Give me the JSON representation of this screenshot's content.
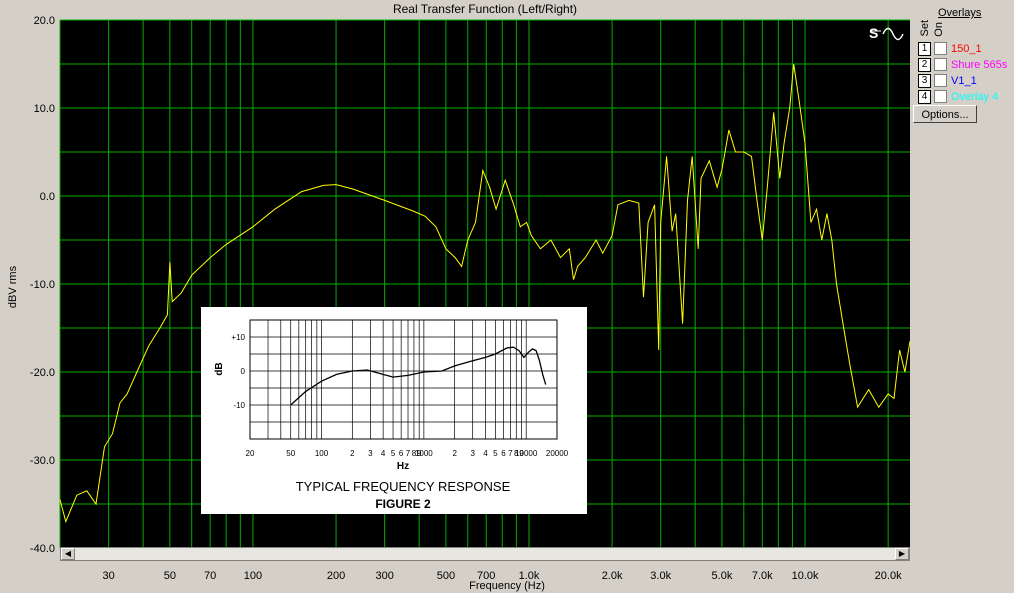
{
  "window": {
    "title": "Real Transfer Function (Left/Right)"
  },
  "overlays": {
    "title": "Overlays",
    "set_label": "Set",
    "on_label": "On",
    "items": [
      {
        "num": "1",
        "name": "150_1",
        "color": "#ff0000"
      },
      {
        "num": "2",
        "name": "Shure 565s",
        "color": "#ff00ff"
      },
      {
        "num": "3",
        "name": "V1_1",
        "color": "#0000ff"
      },
      {
        "num": "4",
        "name": "Overlay 4",
        "color": "#00ffff"
      }
    ],
    "options_label": "Options..."
  },
  "colors": {
    "plot_bg": "#000000",
    "grid": "#00b000",
    "trace": "#ffff00"
  },
  "chart_data": {
    "type": "line",
    "title": "Real Transfer Function (Left/Right)",
    "xlabel": "Frequency (Hz)",
    "ylabel": "dBV rms",
    "x_scale": "log",
    "xlim": [
      20,
      24000
    ],
    "ylim": [
      -40,
      20
    ],
    "grid": true,
    "y_ticks": [
      "20.0",
      "10.0",
      "0.0",
      "-10.0",
      "-20.0",
      "-30.0",
      "-40.0"
    ],
    "x_ticks": [
      {
        "v": 30,
        "t": "30"
      },
      {
        "v": 50,
        "t": "50"
      },
      {
        "v": 70,
        "t": "70"
      },
      {
        "v": 100,
        "t": "100"
      },
      {
        "v": 200,
        "t": "200"
      },
      {
        "v": 300,
        "t": "300"
      },
      {
        "v": 500,
        "t": "500"
      },
      {
        "v": 700,
        "t": "700"
      },
      {
        "v": 1000,
        "t": "1.0k"
      },
      {
        "v": 2000,
        "t": "2.0k"
      },
      {
        "v": 3000,
        "t": "3.0k"
      },
      {
        "v": 5000,
        "t": "5.0k"
      },
      {
        "v": 7000,
        "t": "7.0k"
      },
      {
        "v": 10000,
        "t": "10.0k"
      },
      {
        "v": 20000,
        "t": "20.0k"
      }
    ],
    "series": [
      {
        "points": [
          [
            20,
            -34.5
          ],
          [
            21,
            -37
          ],
          [
            23,
            -34
          ],
          [
            25,
            -33.5
          ],
          [
            27,
            -35
          ],
          [
            29,
            -28.5
          ],
          [
            31,
            -27
          ],
          [
            33,
            -23.5
          ],
          [
            35,
            -22.5
          ],
          [
            38,
            -20
          ],
          [
            42,
            -17
          ],
          [
            46,
            -15
          ],
          [
            49,
            -13.5
          ],
          [
            50,
            -7.5
          ],
          [
            51,
            -12
          ],
          [
            55,
            -11
          ],
          [
            60,
            -9
          ],
          [
            70,
            -7
          ],
          [
            80,
            -5.5
          ],
          [
            100,
            -3.5
          ],
          [
            120,
            -1.5
          ],
          [
            150,
            0.5
          ],
          [
            180,
            1.2
          ],
          [
            200,
            1.3
          ],
          [
            230,
            0.8
          ],
          [
            300,
            -0.5
          ],
          [
            380,
            -1.7
          ],
          [
            420,
            -2.3
          ],
          [
            460,
            -3.5
          ],
          [
            500,
            -6
          ],
          [
            540,
            -7
          ],
          [
            570,
            -8
          ],
          [
            600,
            -5
          ],
          [
            640,
            -3
          ],
          [
            680,
            2.9
          ],
          [
            720,
            1
          ],
          [
            760,
            -1.5
          ],
          [
            820,
            1.8
          ],
          [
            880,
            -1
          ],
          [
            930,
            -3.5
          ],
          [
            980,
            -3
          ],
          [
            1020,
            -4.5
          ],
          [
            1100,
            -6
          ],
          [
            1200,
            -5
          ],
          [
            1300,
            -7
          ],
          [
            1400,
            -6
          ],
          [
            1450,
            -9.5
          ],
          [
            1500,
            -8
          ],
          [
            1600,
            -7
          ],
          [
            1750,
            -5
          ],
          [
            1850,
            -6.5
          ],
          [
            2000,
            -4.5
          ],
          [
            2100,
            -1
          ],
          [
            2300,
            -0.5
          ],
          [
            2500,
            -0.8
          ],
          [
            2600,
            -11.5
          ],
          [
            2700,
            -3
          ],
          [
            2850,
            -1
          ],
          [
            2950,
            -17.5
          ],
          [
            3000,
            -3
          ],
          [
            3150,
            4.5
          ],
          [
            3300,
            -4
          ],
          [
            3400,
            -2
          ],
          [
            3600,
            -14.5
          ],
          [
            3750,
            -0.5
          ],
          [
            3900,
            4.5
          ],
          [
            4100,
            -6
          ],
          [
            4200,
            2
          ],
          [
            4500,
            4
          ],
          [
            4800,
            1
          ],
          [
            5000,
            3
          ],
          [
            5300,
            7.5
          ],
          [
            5600,
            5
          ],
          [
            6000,
            5
          ],
          [
            6400,
            4.5
          ],
          [
            6700,
            -0.5
          ],
          [
            7000,
            -5
          ],
          [
            7300,
            1
          ],
          [
            7700,
            9.5
          ],
          [
            8100,
            2
          ],
          [
            8400,
            6
          ],
          [
            8800,
            10
          ],
          [
            9100,
            15
          ],
          [
            9500,
            11
          ],
          [
            10000,
            6
          ],
          [
            10500,
            -3
          ],
          [
            11000,
            -1.5
          ],
          [
            11500,
            -5
          ],
          [
            12000,
            -2
          ],
          [
            12500,
            -5
          ],
          [
            13000,
            -10
          ],
          [
            13800,
            -15
          ],
          [
            14500,
            -19
          ],
          [
            15500,
            -24
          ],
          [
            17000,
            -22
          ],
          [
            18500,
            -24
          ],
          [
            20000,
            -22.5
          ],
          [
            21000,
            -23
          ],
          [
            22000,
            -17.5
          ],
          [
            23000,
            -20
          ],
          [
            24000,
            -16.5
          ]
        ]
      }
    ]
  },
  "inset": {
    "caption": "TYPICAL FREQUENCY RESPONSE",
    "figure_label": "FIGURE 2",
    "ylabel": "dB",
    "xlabel": "Hz",
    "ytick_labels": [
      "+10",
      "0",
      "-10"
    ],
    "xtick_labels": [
      "20",
      "50",
      "100",
      "2",
      "3",
      "4",
      "5",
      "6",
      "7",
      "8",
      "9",
      "1000",
      "2",
      "3",
      "4",
      "5",
      "6",
      "7",
      "8",
      "9",
      "10000",
      "20000"
    ],
    "curve": [
      [
        50,
        -10
      ],
      [
        70,
        -6
      ],
      [
        100,
        -3
      ],
      [
        140,
        -1
      ],
      [
        200,
        0
      ],
      [
        280,
        0.3
      ],
      [
        400,
        -1
      ],
      [
        500,
        -1.8
      ],
      [
        700,
        -1.3
      ],
      [
        1000,
        -0.3
      ],
      [
        1500,
        0
      ],
      [
        2000,
        1.5
      ],
      [
        3000,
        3
      ],
      [
        4000,
        4
      ],
      [
        5000,
        5
      ],
      [
        6500,
        6.8
      ],
      [
        7500,
        7
      ],
      [
        8500,
        6
      ],
      [
        9500,
        4
      ],
      [
        10500,
        5.5
      ],
      [
        11500,
        6.5
      ],
      [
        12500,
        6
      ],
      [
        13500,
        3
      ],
      [
        14500,
        -1
      ],
      [
        15500,
        -4
      ]
    ]
  }
}
